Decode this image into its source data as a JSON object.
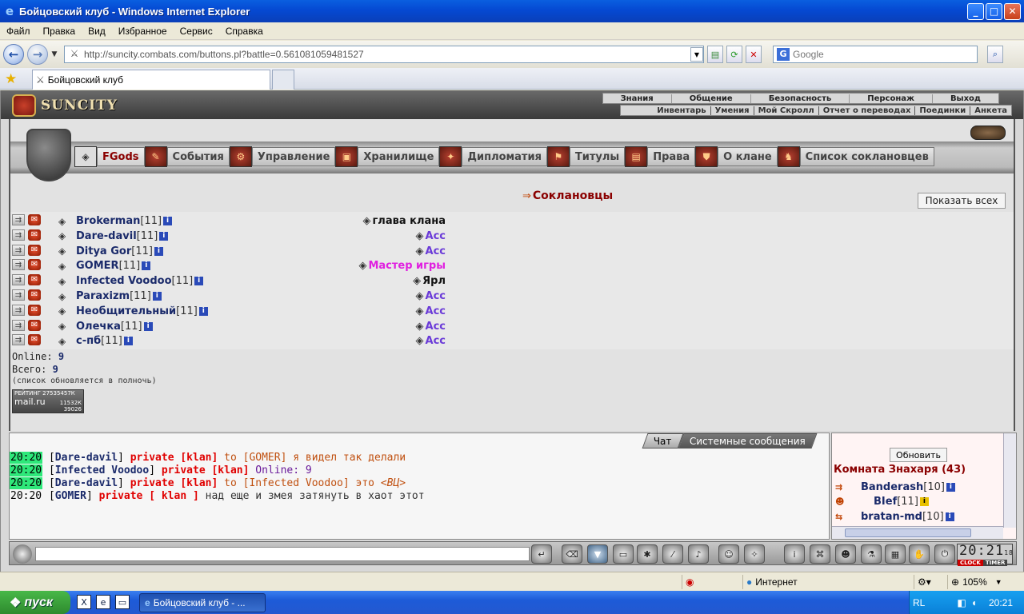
{
  "window": {
    "title": "Бойцовский клуб - Windows Internet Explorer",
    "minimize": "_",
    "maximize": "□",
    "close": "✕"
  },
  "menu": [
    "Файл",
    "Правка",
    "Вид",
    "Избранное",
    "Сервис",
    "Справка"
  ],
  "address": {
    "url": "http://suncity.combats.com/buttons.pl?battle=0.561081059481527",
    "search_placeholder": "Google"
  },
  "tab": {
    "title": "Бойцовский клуб"
  },
  "game": {
    "logo": "SUNCITY",
    "topmenu1": [
      "Знания",
      "Общение",
      "Безопасность",
      "Персонаж",
      "Выход"
    ],
    "topmenu2": [
      "Инвентарь",
      "Умения",
      "Мой Скролл",
      "Отчет о переводах",
      "Поединки",
      "Анкета"
    ],
    "navtabs": [
      "FGods",
      "События",
      "Управление",
      "Хранилище",
      "Дипломатия",
      "Титулы",
      "Права",
      "О клане",
      "Список соклановцев"
    ],
    "clan_title": "Соклановцы",
    "show_all": "Показать всех",
    "members": [
      {
        "name": "Brokerman",
        "level": "[11]",
        "role": "глава клана",
        "role_color": "#111111"
      },
      {
        "name": "Dare-davil",
        "level": "[11]",
        "role": "Асс",
        "role_color": "#6a3ad8"
      },
      {
        "name": "Ditya Gor",
        "level": "[11]",
        "role": "Асс",
        "role_color": "#6a3ad8"
      },
      {
        "name": "GOMER",
        "level": "[11]",
        "role": "Мастер игры",
        "role_color": "#e020e0"
      },
      {
        "name": "Infected Voodoo",
        "level": "[11]",
        "role": "Ярл",
        "role_color": "#111111"
      },
      {
        "name": "Paraxizm",
        "level": "[11]",
        "role": "Асс",
        "role_color": "#6a3ad8"
      },
      {
        "name": "Необщительный",
        "level": "[11]",
        "role": "Асс",
        "role_color": "#6a3ad8"
      },
      {
        "name": "Олечка",
        "level": "[11]",
        "role": "Асс",
        "role_color": "#6a3ad8"
      },
      {
        "name": "с-пб",
        "level": "[11]",
        "role": "Асс",
        "role_color": "#6a3ad8"
      }
    ],
    "stats": {
      "online_label": "Online:",
      "online_value": "9",
      "total_label": "Всего:",
      "total_value": "9",
      "note": "(список обновляется в полночь)"
    },
    "mailru": {
      "line1": "РЕЙТИНГ 27535457К",
      "brand": "mail.ru",
      "n1": "11532К",
      "n2": "39026"
    },
    "chat_tabs": [
      "Чат",
      "Системные сообщения"
    ],
    "chat": [
      {
        "time": "20:20",
        "nick": "Dare-davil",
        "priv": "private [klan]",
        "to": "to [GOMER]",
        "msg": "я видел так делали",
        "em": "",
        "cls": ""
      },
      {
        "time": "20:20",
        "nick": "Infected Voodoo",
        "priv": "private [klan]",
        "to": "",
        "msg": "Online: 9",
        "em": "",
        "cls": "purple"
      },
      {
        "time": "20:20",
        "nick": "Dare-davil",
        "priv": "private [klan]",
        "to": "to [Infected Voodoo]",
        "msg": "это",
        "em": "<ВЦ>",
        "cls": ""
      },
      {
        "time": "20:20",
        "nick": "GOMER",
        "priv": "private [ klan ]",
        "to": "",
        "msg": "над еще и змея затянуть в хаот этот",
        "em": "",
        "cls": "dark"
      }
    ],
    "room": {
      "refresh": "Обновить",
      "title": "Комната Знахаря (43)",
      "users": [
        {
          "name": "Banderash",
          "level": "[10]",
          "info": "blue"
        },
        {
          "name": "BIef",
          "level": "[11]",
          "info": "yellow"
        },
        {
          "name": "bratan-md",
          "level": "[10]",
          "info": "blue"
        }
      ]
    },
    "clock": {
      "time": "20:21",
      "sec": "18",
      "clock_label": "CLOCK",
      "timer_label": "TIMER"
    }
  },
  "statusbar": {
    "zone": "Интернет",
    "zoom": "105%"
  },
  "taskbar": {
    "start": "пуск",
    "item": "Бойцовский клуб - ...",
    "lang": "RL",
    "clock": "20:21"
  }
}
